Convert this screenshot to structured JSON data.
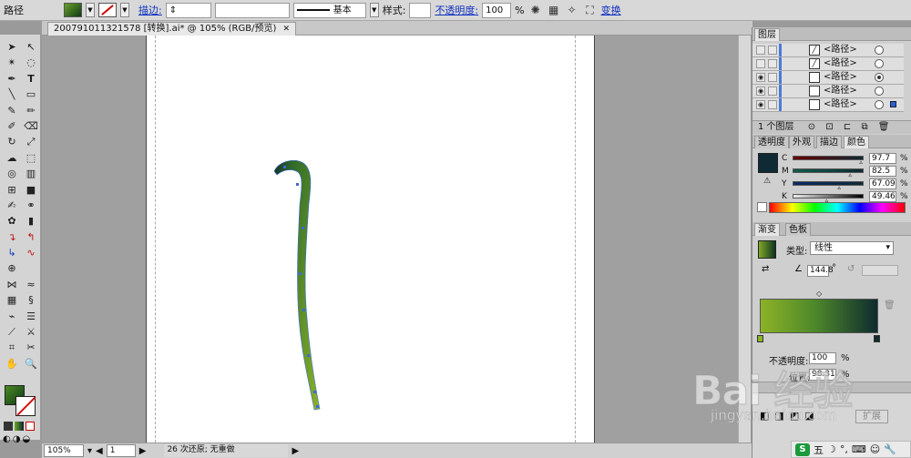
{
  "control_bar": {
    "object_type": "路径",
    "stroke_label": "描边:",
    "brush_label": "基本",
    "style_label": "样式:",
    "opacity_label": "不透明度:",
    "opacity_value": "100",
    "opacity_unit": "%",
    "transform_label": "变换"
  },
  "document": {
    "tab_title": "200791011321578 [转换].ai* @ 105% (RGB/预览)",
    "close_glyph": "✕"
  },
  "status_bar": {
    "zoom": "105%",
    "artboard": "1",
    "history": "26 次还原; 无重做"
  },
  "layers_panel": {
    "tab": "图层",
    "rows": [
      {
        "name": "<路径>",
        "visible": false,
        "target_filled": false
      },
      {
        "name": "<路径>",
        "visible": false,
        "target_filled": false
      },
      {
        "name": "<路径>",
        "visible": true,
        "target_filled": true
      },
      {
        "name": "<路径>",
        "visible": true,
        "target_filled": false
      },
      {
        "name": "<路径>",
        "visible": true,
        "target_filled": false
      }
    ],
    "footer": "1 个图层"
  },
  "color_panel": {
    "tabs": [
      "透明度",
      "外观",
      "描边",
      "颜色"
    ],
    "active_tab": "颜色",
    "preview_color": "#0f2a34",
    "channels": [
      {
        "label": "C",
        "value": "97.7",
        "unit": "%",
        "fraction": 0.977
      },
      {
        "label": "M",
        "value": "82.5",
        "unit": "%",
        "fraction": 0.825
      },
      {
        "label": "Y",
        "value": "67.09",
        "unit": "%",
        "fraction": 0.6709
      },
      {
        "label": "K",
        "value": "49.46",
        "unit": "%",
        "fraction": 0.4946
      }
    ]
  },
  "gradient_panel": {
    "tabs": [
      "渐变",
      "色板"
    ],
    "active_tab": "渐变",
    "type_label": "类型:",
    "type_value": "线性",
    "angle_value": "144.8",
    "angle_unit": "°",
    "start_color": "#8cb226",
    "end_color": "#0f2b2e",
    "opacity_label": "不透明度:",
    "opacity_value": "100",
    "position_label": "位置:",
    "position_value": "98.31",
    "unit": "%"
  },
  "bottom_panel": {
    "expand_label": "扩展"
  },
  "fill_color": "#3d7a20",
  "watermark": {
    "brand": "Bai 经验",
    "url": "jingyan.baidu.com"
  },
  "tray": {
    "ime_label": "五"
  }
}
